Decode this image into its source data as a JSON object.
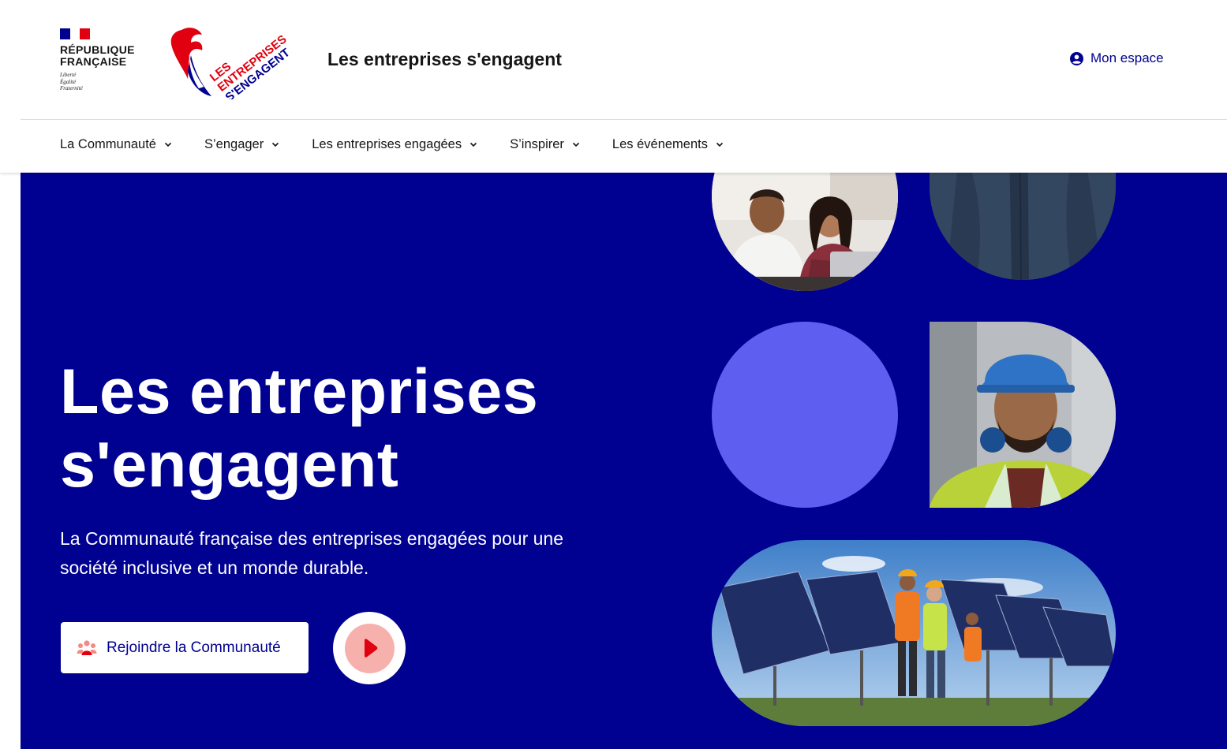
{
  "header": {
    "rf_name": "RÉPUBLIQUE\nFRANÇAISE",
    "rf_motto": "Liberté\nÉgalité\nFraternité",
    "logo_text": [
      "LES",
      "ENTREPRISES",
      "S'ENGAGENT"
    ],
    "site_title": "Les entreprises s'engagent",
    "account_label": "Mon espace"
  },
  "nav": {
    "items": [
      {
        "label": "La Communauté"
      },
      {
        "label": "S’engager"
      },
      {
        "label": "Les entreprises engagées"
      },
      {
        "label": "S’inspirer"
      },
      {
        "label": "Les événements"
      }
    ]
  },
  "hero": {
    "title": "Les entreprises\ns'engagent",
    "subtitle": "La Communauté française des entreprises engagées pour une société inclusive et un monde durable.",
    "cta_label": "Rejoindre la Communauté"
  },
  "colors": {
    "brand_blue": "#000091",
    "flag_blue": "#000091",
    "flag_red": "#e1000f",
    "accent_purple": "#5e5ef0",
    "play_pink": "#f7b1ad",
    "play_red": "#e1000f"
  },
  "icons": {
    "account": "user-circle-icon",
    "nav_chevron": "chevron-down-icon",
    "cta": "community-icon",
    "play": "play-icon"
  }
}
